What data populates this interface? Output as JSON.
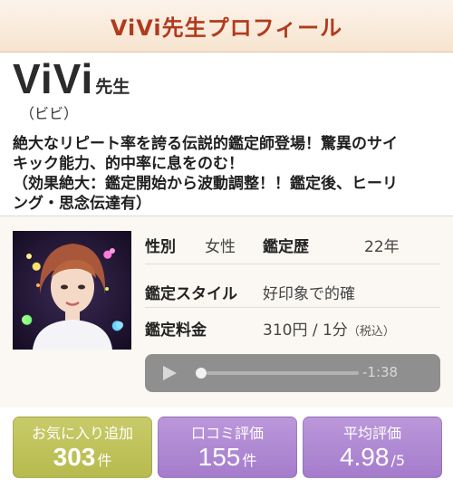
{
  "header": {
    "title": "ViVi先生プロフィール"
  },
  "profile": {
    "name": "ViVi",
    "name_suffix": "先生",
    "reading": "（ビビ）",
    "catch_line1": "絶大なリピート率を誇る伝説的鑑定師登場！驚異のサイ",
    "catch_line2": "キック能力、的中率に息をのむ！",
    "catch_line3": "（効果絶大：鑑定開始から波動調整！！鑑定後、ヒーリ",
    "catch_line4": "ング・思念伝達有）"
  },
  "info": {
    "gender_label": "性別",
    "gender_value": "女性",
    "career_label": "鑑定歴",
    "career_value": "22年",
    "style_label": "鑑定スタイル",
    "style_value": "好印象で的確",
    "fee_label": "鑑定料金",
    "fee_value": "310円 / 1分",
    "fee_tax": "（税込）"
  },
  "player": {
    "time": "-1:38",
    "progress": 0.0
  },
  "stats": {
    "favorite_label": "お気に入り追加",
    "favorite_value": "303",
    "favorite_unit": "件",
    "review_label": "口コミ評価",
    "review_value": "155",
    "review_unit": "件",
    "average_label": "平均評価",
    "average_value": "4.98",
    "average_unit": "/5"
  },
  "colors": {
    "header_text": "#b23a1e",
    "favorite_card": "#bfc25a",
    "review_card": "#b08ad3",
    "average_card": "#b08ad3"
  },
  "icons": {
    "play": "play-icon"
  }
}
